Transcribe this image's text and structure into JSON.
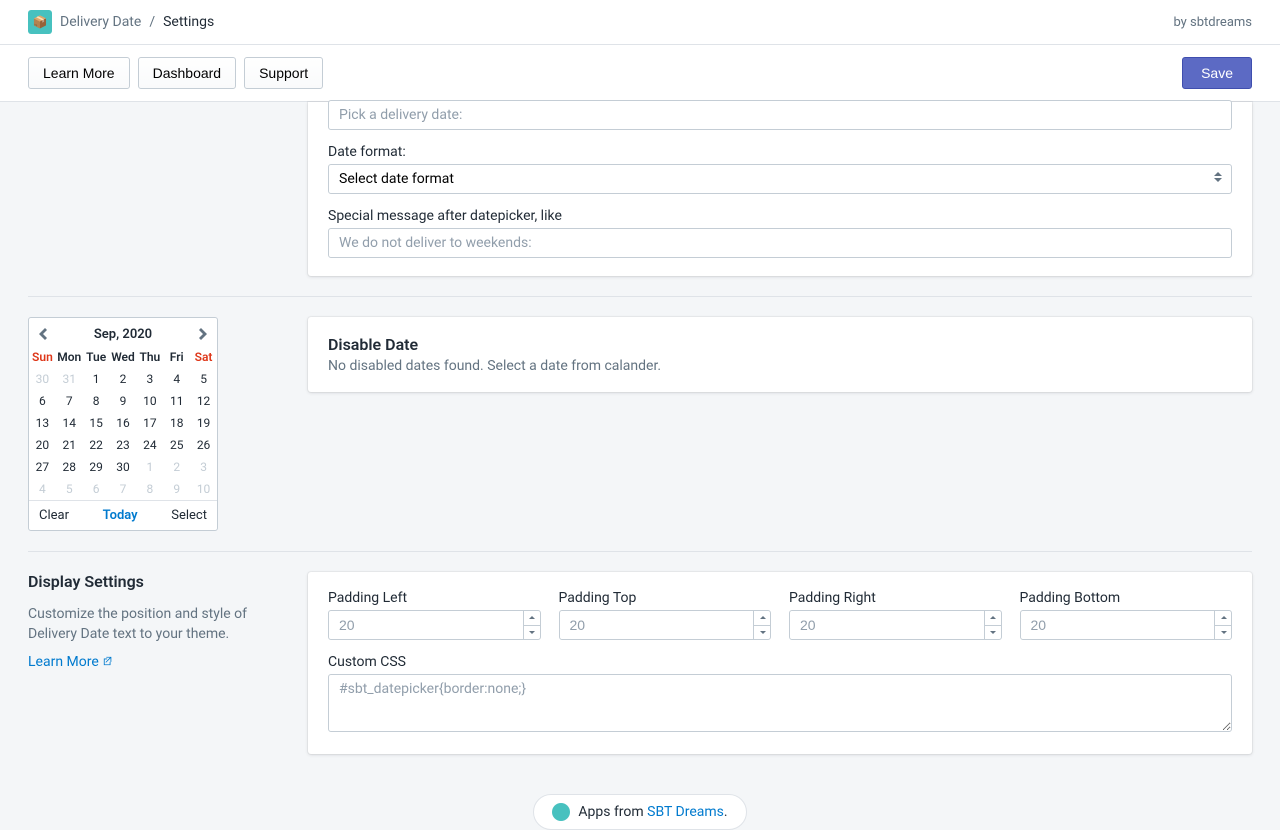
{
  "header": {
    "app_name": "Delivery Date",
    "page": "Settings",
    "byline_prefix": "by ",
    "byline_author": "sbtdreams"
  },
  "toolbar": {
    "learn_more": "Learn More",
    "dashboard": "Dashboard",
    "support": "Support",
    "save": "Save"
  },
  "form": {
    "pick_placeholder": "Pick a delivery date:",
    "date_format_label": "Date format:",
    "date_format_selected": "Select date format",
    "special_msg_label": "Special message after datepicker, like",
    "special_msg_placeholder": "We do not deliver to weekends:"
  },
  "calendar": {
    "title": "Sep, 2020",
    "dow": [
      "Sun",
      "Mon",
      "Tue",
      "Wed",
      "Thu",
      "Fri",
      "Sat"
    ],
    "weeks": [
      [
        {
          "d": "30",
          "muted": true
        },
        {
          "d": "31",
          "muted": true
        },
        {
          "d": "1"
        },
        {
          "d": "2"
        },
        {
          "d": "3"
        },
        {
          "d": "4"
        },
        {
          "d": "5"
        }
      ],
      [
        {
          "d": "6"
        },
        {
          "d": "7"
        },
        {
          "d": "8"
        },
        {
          "d": "9"
        },
        {
          "d": "10"
        },
        {
          "d": "11"
        },
        {
          "d": "12"
        }
      ],
      [
        {
          "d": "13"
        },
        {
          "d": "14"
        },
        {
          "d": "15"
        },
        {
          "d": "16"
        },
        {
          "d": "17"
        },
        {
          "d": "18"
        },
        {
          "d": "19"
        }
      ],
      [
        {
          "d": "20"
        },
        {
          "d": "21"
        },
        {
          "d": "22"
        },
        {
          "d": "23"
        },
        {
          "d": "24"
        },
        {
          "d": "25"
        },
        {
          "d": "26"
        }
      ],
      [
        {
          "d": "27"
        },
        {
          "d": "28"
        },
        {
          "d": "29"
        },
        {
          "d": "30"
        },
        {
          "d": "1",
          "muted": true
        },
        {
          "d": "2",
          "muted": true
        },
        {
          "d": "3",
          "muted": true
        }
      ],
      [
        {
          "d": "4",
          "muted": true
        },
        {
          "d": "5",
          "muted": true
        },
        {
          "d": "6",
          "muted": true
        },
        {
          "d": "7",
          "muted": true
        },
        {
          "d": "8",
          "muted": true
        },
        {
          "d": "9",
          "muted": true
        },
        {
          "d": "10",
          "muted": true
        }
      ]
    ],
    "clear": "Clear",
    "today": "Today",
    "select": "Select"
  },
  "disable": {
    "title": "Disable Date",
    "msg": "No disabled dates found. Select a date from calander."
  },
  "display": {
    "title": "Display Settings",
    "desc": "Customize the position and style of Delivery Date text to your theme.",
    "learn_more": "Learn More"
  },
  "padding": {
    "labels": {
      "left": "Padding Left",
      "top": "Padding Top",
      "right": "Padding Right",
      "bottom": "Padding Bottom"
    },
    "placeholder": "20"
  },
  "css": {
    "label": "Custom CSS",
    "placeholder": "#sbt_datepicker{border:none;}"
  },
  "footer": {
    "prefix": "Apps from ",
    "brand": "SBT Dreams",
    "suffix": "."
  }
}
